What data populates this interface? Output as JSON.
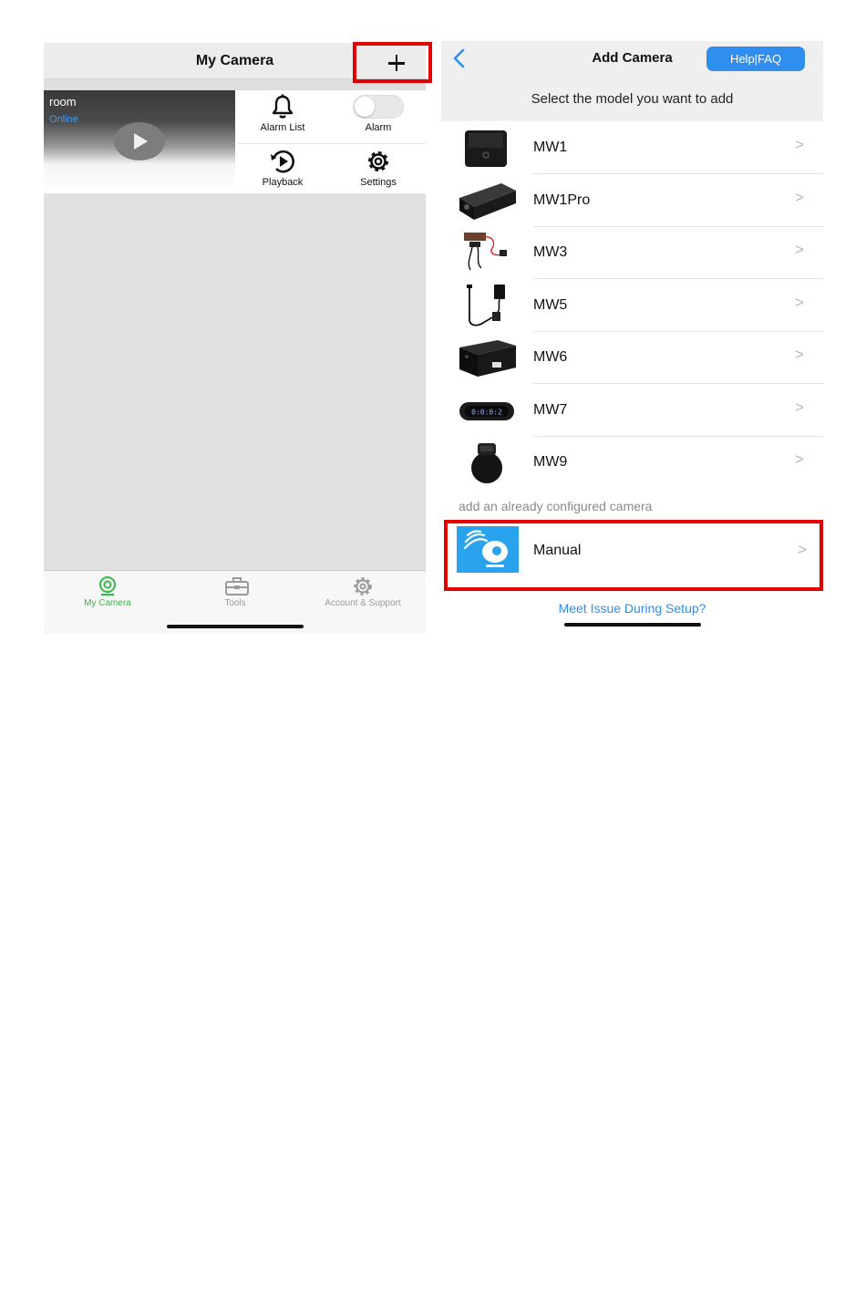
{
  "left_screen": {
    "header": {
      "title": "My Camera",
      "add_icon": "plus-icon"
    },
    "camera_card": {
      "name": "room",
      "status": "Online",
      "actions": {
        "alarm_list": {
          "label": "Alarm List",
          "icon": "bell-icon"
        },
        "alarm": {
          "label": "Alarm",
          "toggle_on": false
        },
        "playback": {
          "label": "Playback",
          "icon": "playback-icon"
        },
        "settings": {
          "label": "Settings",
          "icon": "gear-icon"
        }
      }
    },
    "tabbar": {
      "tabs": [
        {
          "label": "My Camera",
          "icon": "webcam-icon",
          "active": true
        },
        {
          "label": "Tools",
          "icon": "toolbox-icon",
          "active": false
        },
        {
          "label": "Account & Support",
          "icon": "gear-icon",
          "active": false
        }
      ]
    }
  },
  "right_screen": {
    "header": {
      "title": "Add Camera",
      "help_button": "Help|FAQ",
      "back_icon": "chevron-left-icon",
      "prompt": "Select the model you want to add"
    },
    "models": [
      {
        "name": "MW1"
      },
      {
        "name": "MW1Pro"
      },
      {
        "name": "MW3"
      },
      {
        "name": "MW5"
      },
      {
        "name": "MW6"
      },
      {
        "name": "MW7",
        "display_text": "0:0:0:2"
      },
      {
        "name": "MW9"
      }
    ],
    "configured_caption": "add an already configured camera",
    "manual": {
      "label": "Manual",
      "icon": "wifi-camera-icon"
    },
    "setup_issue_link": "Meet Issue During Setup?",
    "chevron_glyph": ">"
  },
  "colors": {
    "highlight_red": "#e30000",
    "accent_blue": "#2f8ef0",
    "active_green": "#36b84a",
    "online_blue": "#3b9cf2"
  }
}
